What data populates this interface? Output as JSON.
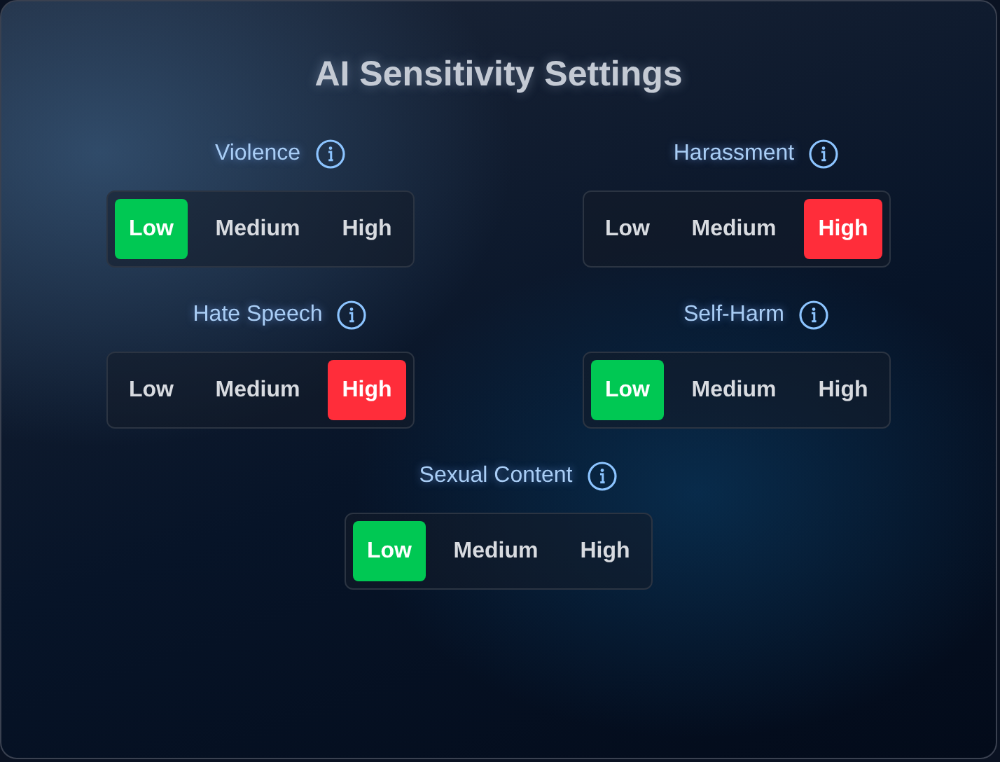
{
  "title": "AI Sensitivity Settings",
  "categories": [
    {
      "label": "Violence",
      "options": [
        {
          "label": "Low",
          "selected": true,
          "color": "#00c853"
        },
        {
          "label": "Medium",
          "selected": false
        },
        {
          "label": "High",
          "selected": false
        }
      ]
    },
    {
      "label": "Harassment",
      "options": [
        {
          "label": "Low",
          "selected": false
        },
        {
          "label": "Medium",
          "selected": false
        },
        {
          "label": "High",
          "selected": true,
          "color": "#ff2d3a"
        }
      ]
    },
    {
      "label": "Hate Speech",
      "options": [
        {
          "label": "Low",
          "selected": false
        },
        {
          "label": "Medium",
          "selected": false
        },
        {
          "label": "High",
          "selected": true,
          "color": "#ff2d3a"
        }
      ]
    },
    {
      "label": "Self-Harm",
      "options": [
        {
          "label": "Low",
          "selected": true,
          "color": "#00c853"
        },
        {
          "label": "Medium",
          "selected": false
        },
        {
          "label": "High",
          "selected": false
        }
      ]
    },
    {
      "label": "Sexual Content",
      "options": [
        {
          "label": "Low",
          "selected": true,
          "color": "#00c853"
        },
        {
          "label": "Medium",
          "selected": false
        },
        {
          "label": "High",
          "selected": false
        }
      ]
    }
  ]
}
